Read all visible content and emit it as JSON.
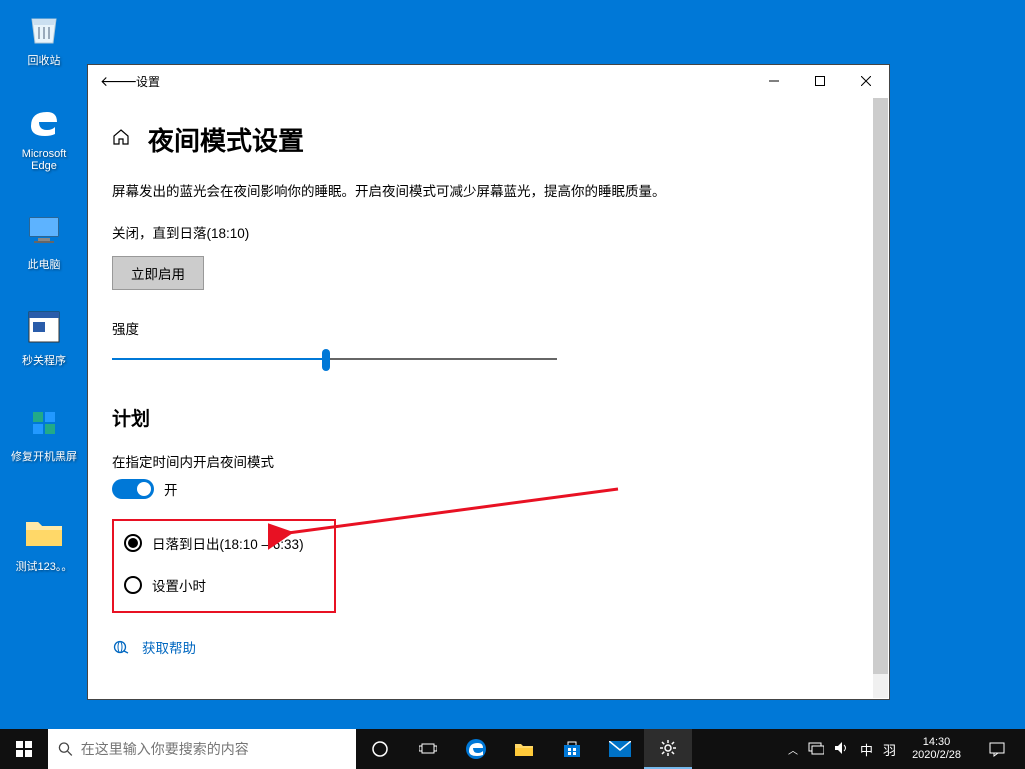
{
  "desktop_icons": [
    {
      "key": "recycle",
      "label": "回收站"
    },
    {
      "key": "edge",
      "label": "Microsoft Edge"
    },
    {
      "key": "thispc",
      "label": "此电脑"
    },
    {
      "key": "seckill",
      "label": "秒关程序"
    },
    {
      "key": "fixboot",
      "label": "修复开机黑屏"
    },
    {
      "key": "testfolder",
      "label": "测试123。。"
    }
  ],
  "window": {
    "title": "设置",
    "page_title": "夜间模式设置",
    "description": "屏幕发出的蓝光会在夜间影响你的睡眠。开启夜间模式可减少屏幕蓝光，提高你的睡眠质量。",
    "status": "关闭，直到日落(18:10)",
    "enable_now": "立即启用",
    "strength_label": "强度",
    "strength_value": 48,
    "plan_heading": "计划",
    "schedule_label": "在指定时间内开启夜间模式",
    "toggle_state": "开",
    "radio_sunset": "日落到日出(18:10 – 6:33)",
    "radio_sethours": "设置小时",
    "help_text": "获取帮助"
  },
  "taskbar": {
    "search_placeholder": "在这里输入你要搜索的内容",
    "ime": "中",
    "ime2": "羽",
    "time": "14:30",
    "date": "2020/2/28"
  }
}
